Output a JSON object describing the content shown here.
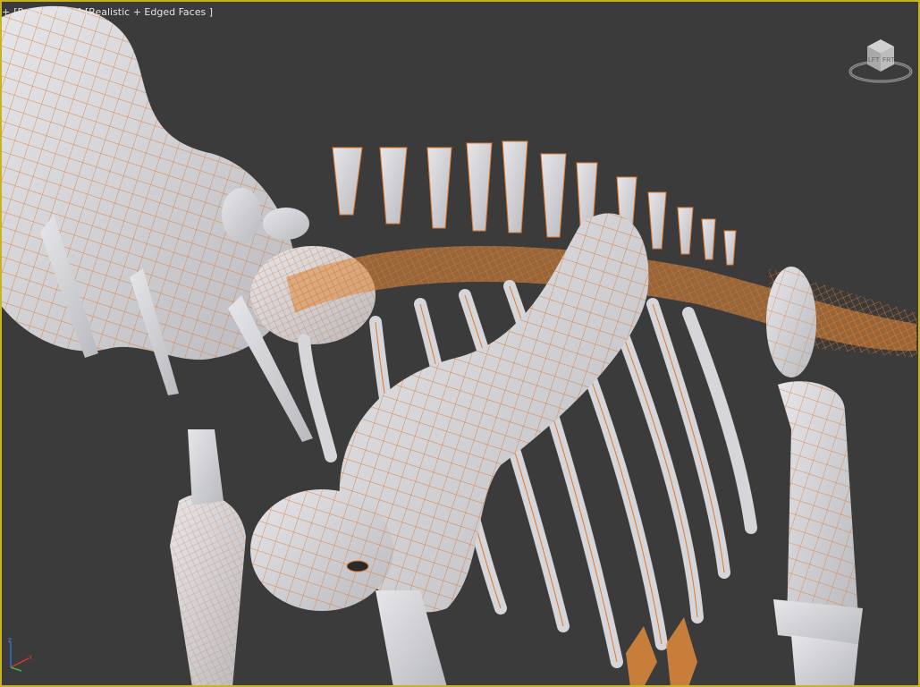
{
  "viewport": {
    "menu_label": "+",
    "view_label": "[Perspective ]",
    "shading_label": "[Realistic + Edged Faces ]",
    "active_border_color": "#c8b420",
    "background_color": "#3b3b3b"
  },
  "viewcube": {
    "icon": "viewcube-icon",
    "left_face": "LFT",
    "front_face": "FRT"
  },
  "axis_tripod": {
    "icon": "axis-tripod-icon",
    "x_color": "#d23a2a",
    "y_color": "#39b54a",
    "z_color": "#3a6bd6"
  },
  "scene": {
    "model_surface_color": "#d8d8dc",
    "wireframe_edge_color": "#e0782a"
  }
}
